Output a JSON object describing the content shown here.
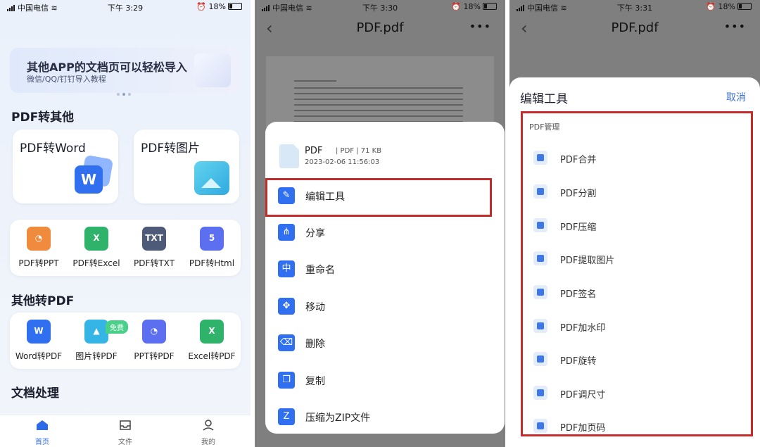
{
  "status": {
    "carrier": "中国电信",
    "battery": "18%",
    "times": [
      "下午 3:29",
      "下午 3:30",
      "下午 3:31"
    ]
  },
  "panel1": {
    "banner": {
      "title": "其他APP的文档页可以轻松导入",
      "subtitle": "微信/QQ/钉钉导入教程"
    },
    "section_pdf_to_other": "PDF转其他",
    "big_cards": [
      {
        "label": "PDF转Word",
        "icon": "word-icon"
      },
      {
        "label": "PDF转图片",
        "icon": "image-icon"
      }
    ],
    "pdf_tools": [
      {
        "label": "PDF转PPT",
        "glyph": "◔",
        "color": "#f08a3c"
      },
      {
        "label": "PDF转Excel",
        "glyph": "X",
        "color": "#2fb36b"
      },
      {
        "label": "PDF转TXT",
        "glyph": "TXT",
        "color": "#4d5a78"
      },
      {
        "label": "PDF转Html",
        "glyph": "5",
        "color": "#5b6ff0"
      }
    ],
    "section_other_to_pdf": "其他转PDF",
    "free_badge": "免费",
    "to_pdf_tools": [
      {
        "label": "Word转PDF",
        "glyph": "W",
        "color": "#2f6ff0"
      },
      {
        "label": "图片转PDF",
        "glyph": "▲",
        "color": "#35b4e6"
      },
      {
        "label": "PPT转PDF",
        "glyph": "◔",
        "color": "#5b6ff0"
      },
      {
        "label": "Excel转PDF",
        "glyph": "X",
        "color": "#2fb36b"
      }
    ],
    "section_doc_processing": "文档处理",
    "tabs": [
      {
        "label": "首页",
        "icon": "home-icon"
      },
      {
        "label": "文件",
        "icon": "inbox-icon"
      },
      {
        "label": "我的",
        "icon": "user-icon"
      }
    ]
  },
  "panel2": {
    "title": "PDF.pdf",
    "file": {
      "name": "PDF",
      "meta": "| PDF | 71 KB",
      "date": "2023-02-06 11:56:03"
    },
    "actions": [
      {
        "label": "编辑工具",
        "glyph": "✎",
        "icon": "edit-icon"
      },
      {
        "label": "分享",
        "glyph": "⋔",
        "icon": "share-icon"
      },
      {
        "label": "重命名",
        "glyph": "中",
        "icon": "rename-icon"
      },
      {
        "label": "移动",
        "glyph": "✥",
        "icon": "move-icon"
      },
      {
        "label": "删除",
        "glyph": "⌫",
        "icon": "delete-icon"
      },
      {
        "label": "复制",
        "glyph": "❐",
        "icon": "copy-icon"
      },
      {
        "label": "压缩为ZIP文件",
        "glyph": "Z",
        "icon": "zip-icon"
      }
    ]
  },
  "panel3": {
    "title": "PDF.pdf",
    "header": "编辑工具",
    "cancel": "取消",
    "group": "PDF管理",
    "items": [
      {
        "label": "PDF合并",
        "icon": "merge-icon"
      },
      {
        "label": "PDF分割",
        "icon": "split-icon"
      },
      {
        "label": "PDF压缩",
        "icon": "compress-icon"
      },
      {
        "label": "PDF提取图片",
        "icon": "extract-image-icon"
      },
      {
        "label": "PDF签名",
        "icon": "signature-icon"
      },
      {
        "label": "PDF加水印",
        "icon": "watermark-icon"
      },
      {
        "label": "PDF旋转",
        "icon": "rotate-icon"
      },
      {
        "label": "PDF调尺寸",
        "icon": "resize-icon"
      },
      {
        "label": "PDF加页码",
        "icon": "page-number-icon"
      }
    ]
  },
  "colors": {
    "accent": "#2d6ae8",
    "highlight_border": "#c42b2b"
  }
}
